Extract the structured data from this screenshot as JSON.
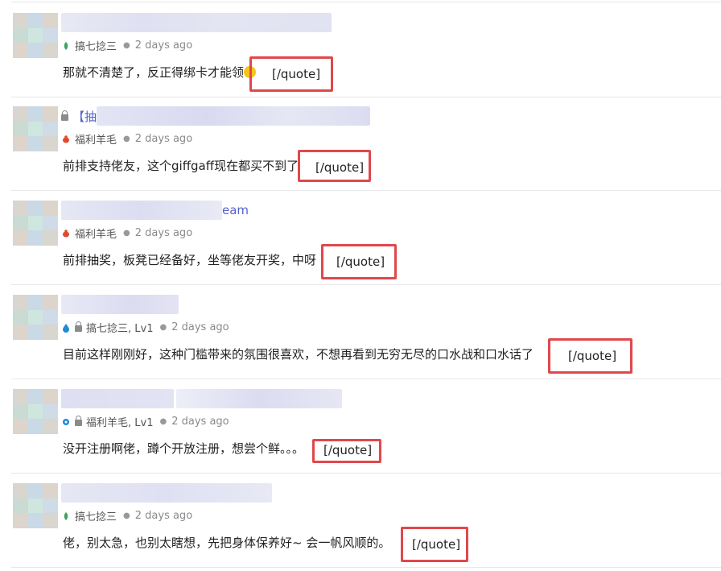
{
  "posts": [
    {
      "author": "搞七捻三",
      "time": "2 days ago",
      "title": "",
      "content": "那就不清楚了，反正得绑卡才能领",
      "quote": "[/quote]",
      "category_color": "#3aa55c"
    },
    {
      "author": "福利羊毛",
      "time": "2 days ago",
      "title": "【抽",
      "content": "前排支持佬友，这个giffgaff现在都买不到了",
      "quote": "[/quote]",
      "category_color": "#e04a2b"
    },
    {
      "author": "福利羊毛",
      "time": "2 days ago",
      "title": "eam",
      "content": "前排抽奖，板凳已经备好，坐等佬友开奖，中呀",
      "quote": "[/quote]",
      "category_color": "#e04a2b"
    },
    {
      "author": "搞七捻三, Lv1",
      "time": "2 days ago",
      "title": "",
      "content": "目前这样刚刚好，这种门槛带来的氛围很喜欢，不想再看到无穷无尽的口水战和口水话了",
      "quote": "[/quote]",
      "category_color": "#1f8ad6"
    },
    {
      "author": "福利羊毛, Lv1",
      "time": "2 days ago",
      "title": "",
      "content": "没开注册啊佬，蹲个开放注册，想尝个鲜。。。",
      "quote": "[/quote]",
      "category_color": "#1f8ad6"
    },
    {
      "author": "搞七捻三",
      "time": "2 days ago",
      "title": "",
      "content": "佬，别太急，也别太瞎想，先把身体保养好~ 会一帆风顺的。",
      "quote": "[/quote]",
      "category_color": "#3aa55c"
    }
  ],
  "colors": {
    "highlight": "#e0484c",
    "link": "#5663c9"
  }
}
